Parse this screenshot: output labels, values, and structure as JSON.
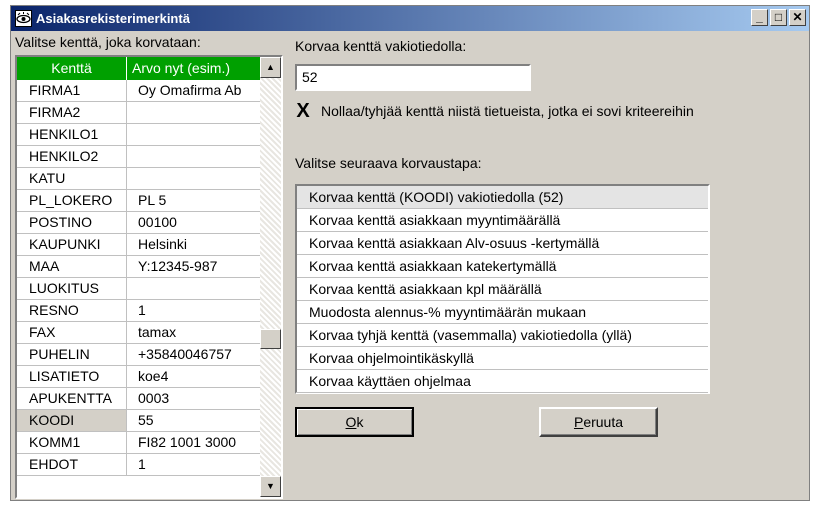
{
  "window": {
    "title": "Asiakasrekisterimerkintä",
    "controls": {
      "minimize": "_",
      "maximize": "□",
      "close": "✕"
    }
  },
  "left": {
    "label": "Valitse kenttä, joka korvataan:",
    "grid": {
      "headers": {
        "field": "Kenttä",
        "value": "Arvo nyt (esim.)"
      },
      "rows": [
        {
          "field": "FIRMA1",
          "value": "Oy Omafirma Ab"
        },
        {
          "field": "FIRMA2",
          "value": ""
        },
        {
          "field": "HENKILO1",
          "value": ""
        },
        {
          "field": "HENKILO2",
          "value": ""
        },
        {
          "field": "KATU",
          "value": ""
        },
        {
          "field": "PL_LOKERO",
          "value": "PL 5"
        },
        {
          "field": "POSTINO",
          "value": "00100"
        },
        {
          "field": "KAUPUNKI",
          "value": "Helsinki"
        },
        {
          "field": "MAA",
          "value": "Y:12345-987"
        },
        {
          "field": "LUOKITUS",
          "value": ""
        },
        {
          "field": "RESNO",
          "value": "1"
        },
        {
          "field": "FAX",
          "value": "tamax"
        },
        {
          "field": "PUHELIN",
          "value": "+35840046757"
        },
        {
          "field": "LISATIETO",
          "value": "koe4"
        },
        {
          "field": "APUKENTTA",
          "value": "0003"
        },
        {
          "field": "KOODI",
          "value": "55"
        },
        {
          "field": "KOMM1",
          "value": "FI82 1001 3000"
        },
        {
          "field": "EHDOT",
          "value": "1"
        }
      ],
      "selected_field": "KOODI"
    }
  },
  "right": {
    "constant_label": "Korvaa kenttä vakiotiedolla:",
    "constant_value": "52",
    "clear_checkbox": {
      "checked": true,
      "mark": "X",
      "label": "Nollaa/tyhjää kenttä niistä tietueista, jotka ei sovi kriteereihin"
    },
    "method_label": "Valitse seuraava korvaustapa:",
    "methods": [
      "Korvaa kenttä (KOODI) vakiotiedolla (52)",
      "Korvaa kenttä asiakkaan myyntimäärällä",
      "Korvaa kenttä asiakkaan Alv-osuus -kertymällä",
      "Korvaa kenttä asiakkaan katekertymällä",
      "Korvaa kenttä asiakkaan kpl määrällä",
      "Muodosta alennus-% myyntimäärän mukaan",
      "Korvaa tyhjä kenttä (vasemmalla) vakiotiedolla (yllä)",
      "Korvaa ohjelmointikäskyllä",
      "Korvaa käyttäen ohjelmaa"
    ],
    "selected_method_index": 0
  },
  "buttons": {
    "ok": {
      "mnemonic": "O",
      "rest": "k"
    },
    "cancel": {
      "mnemonic": "P",
      "rest": "eruuta"
    }
  },
  "colors": {
    "title_gradient_start": "#0a246a",
    "grid_header": "#00a000",
    "dialog_bg": "#d4d0c8"
  }
}
